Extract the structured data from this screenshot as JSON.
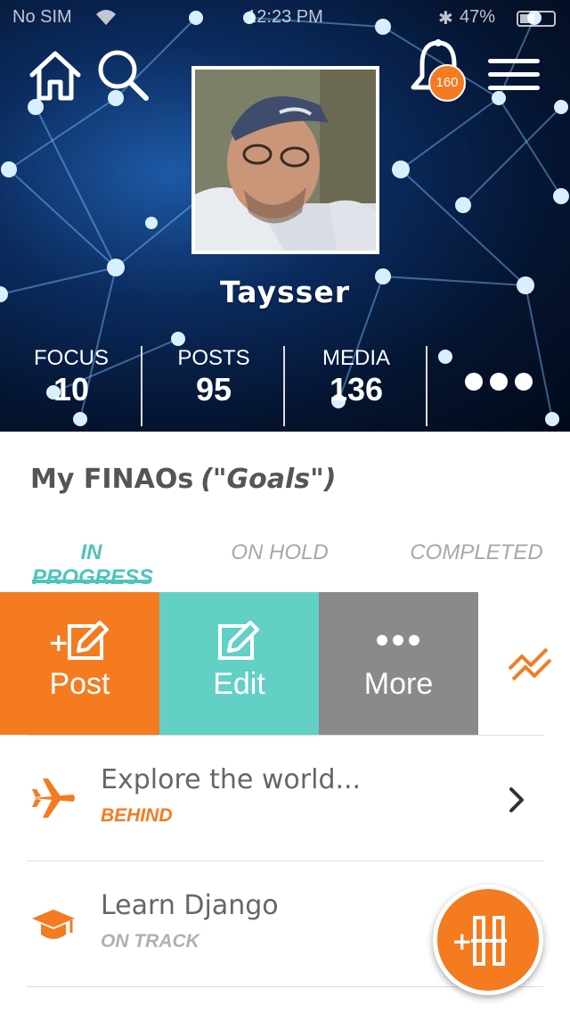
{
  "status_bar": {
    "carrier": "No SIM",
    "time": "12:23 PM",
    "battery": "47%"
  },
  "header": {
    "notifications_count": "160",
    "profile_name": "Taysser",
    "stats": [
      {
        "label": "FOCUS",
        "value": "10"
      },
      {
        "label": "POSTS",
        "value": "95"
      },
      {
        "label": "MEDIA",
        "value": "136"
      }
    ]
  },
  "main": {
    "section_title": "My FINAOs",
    "section_subtitle": "(\"Goals\")",
    "tabs": [
      {
        "label": "IN PROGRESS",
        "active": true
      },
      {
        "label": "ON HOLD",
        "active": false
      },
      {
        "label": "COMPLETED",
        "active": false
      }
    ],
    "actions": {
      "post_label": "Post",
      "edit_label": "Edit",
      "more_label": "More"
    },
    "goals": [
      {
        "title": "Explore the world...",
        "status": "BEHIND",
        "icon": "airplane-icon",
        "status_color": "#f47b20"
      },
      {
        "title": "Learn Django",
        "status": "ON TRACK",
        "icon": "graduation-cap-icon",
        "status_color": "#b0b0b0"
      }
    ]
  },
  "colors": {
    "accent_orange": "#f47b20",
    "accent_teal": "#63d0c6",
    "tab_active": "#4ec4bd",
    "more_gray": "#8a8a8a"
  }
}
